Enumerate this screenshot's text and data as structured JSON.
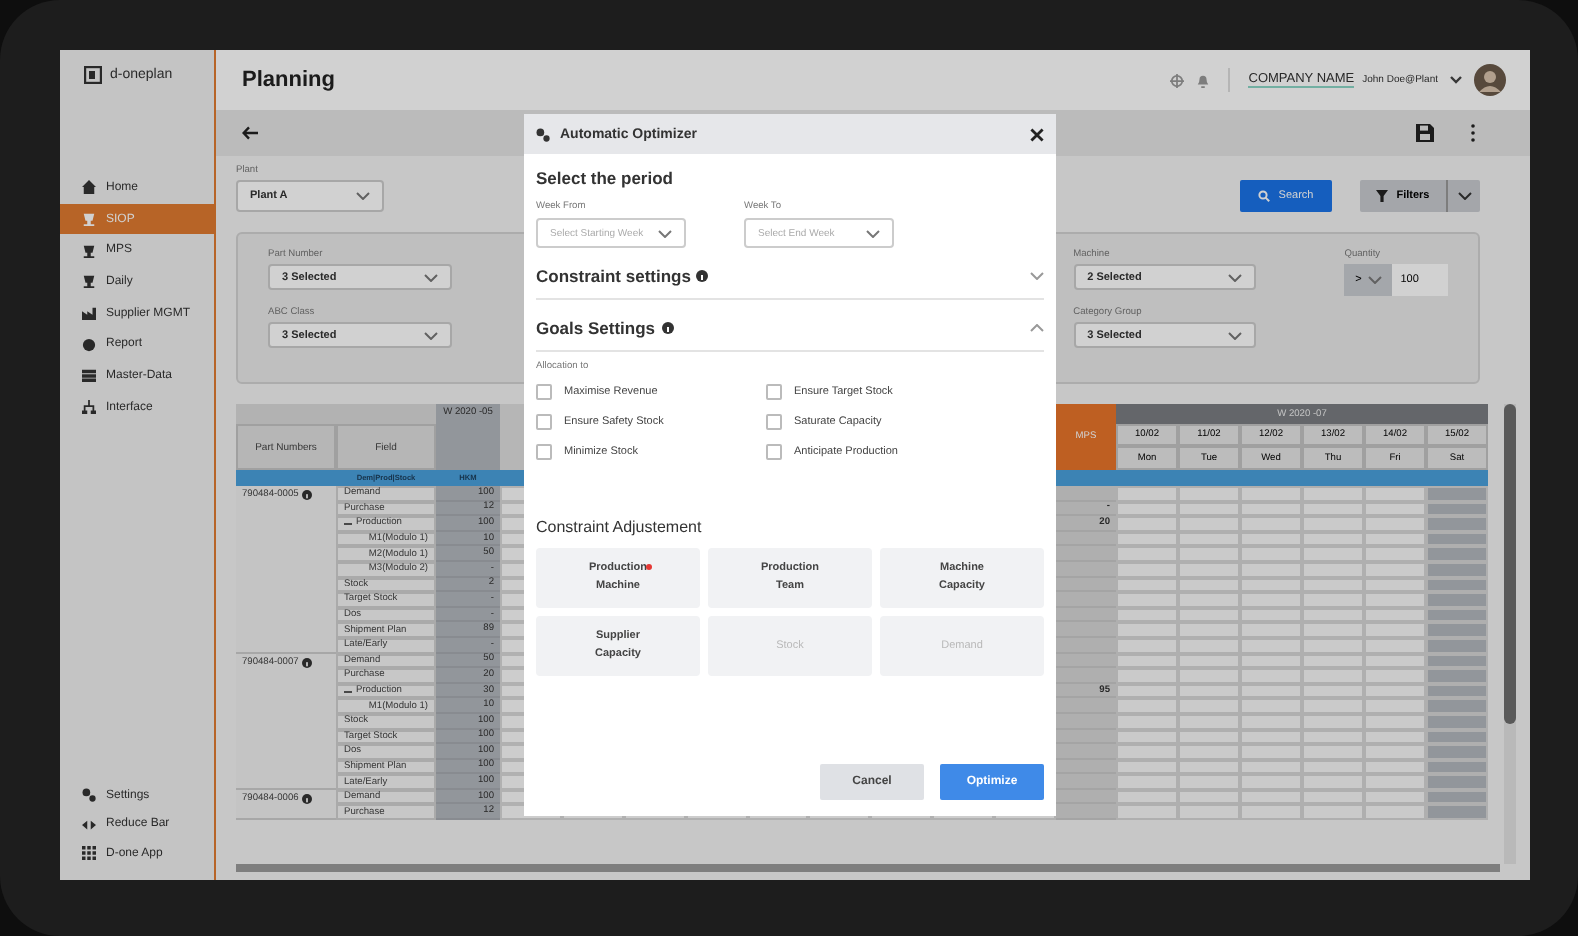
{
  "brand": {
    "name": "d-oneplan"
  },
  "sidebar": {
    "items": [
      {
        "label": "Home",
        "selected": false
      },
      {
        "label": "SIOP",
        "selected": true
      },
      {
        "label": "MPS",
        "selected": false
      },
      {
        "label": "Daily",
        "selected": false
      },
      {
        "label": "Supplier MGMT",
        "selected": false
      },
      {
        "label": "Report",
        "selected": false
      },
      {
        "label": "Master-Data",
        "selected": false
      },
      {
        "label": "Interface",
        "selected": false
      }
    ],
    "footer": [
      {
        "label": "Settings"
      },
      {
        "label": "Reduce Bar"
      },
      {
        "label": "D-one App"
      }
    ]
  },
  "header": {
    "title": "Planning",
    "company": "COMPANY NAME",
    "user": "John Doe@Plant"
  },
  "plant": {
    "label": "Plant",
    "value": "Plant A"
  },
  "search_button": {
    "label": "Search"
  },
  "filters_button": {
    "label": "Filters"
  },
  "filters": [
    {
      "label": "Part Number",
      "value": "3 Selected"
    },
    {
      "label": "ABC Class",
      "value": "3 Selected"
    },
    {
      "label": "Machine",
      "value": "2 Selected"
    },
    {
      "label": "Category Group",
      "value": "3 Selected"
    }
  ],
  "quantity": {
    "label": "Quantity",
    "operator": ">",
    "value": "100"
  },
  "table": {
    "part_header": "Part Numbers",
    "field_header": "Field",
    "week_a": "W 2020 -05",
    "mps_header": "MPS",
    "week_b": "W 2020 -07",
    "days": [
      {
        "date": "10/02",
        "day": "Mon"
      },
      {
        "date": "11/02",
        "day": "Tue"
      },
      {
        "date": "12/02",
        "day": "Wed"
      },
      {
        "date": "13/02",
        "day": "Thu"
      },
      {
        "date": "14/02",
        "day": "Fri"
      },
      {
        "date": "15/02",
        "day": "Sat"
      }
    ],
    "band": {
      "field": "Dem|Prod|Stock",
      "week_a": "HKM"
    },
    "groups": [
      {
        "part": "790484-0005",
        "rows": [
          {
            "field": "Demand",
            "week_a": "100"
          },
          {
            "field": "Purchase",
            "week_a": "12",
            "mps": "-"
          },
          {
            "field": "Production",
            "week_a": "100",
            "mps": "20",
            "expanded": true,
            "children": [
              {
                "field": "M1(Modulo 1)",
                "week_a": "10"
              },
              {
                "field": "M2(Modulo 1)",
                "week_a": "50"
              },
              {
                "field": "M3(Modulo 2)",
                "week_a": "-"
              }
            ]
          },
          {
            "field": "Stock",
            "week_a": "2"
          },
          {
            "field": "Target Stock",
            "week_a": "-"
          },
          {
            "field": "Dos",
            "week_a": "-"
          },
          {
            "field": "Shipment Plan",
            "week_a": "89"
          },
          {
            "field": "Late/Early",
            "week_a": "-"
          }
        ]
      },
      {
        "part": "790484-0007",
        "rows": [
          {
            "field": "Demand",
            "week_a": "50"
          },
          {
            "field": "Purchase",
            "week_a": "20"
          },
          {
            "field": "Production",
            "week_a": "30",
            "mps": "95",
            "expanded": true,
            "children": [
              {
                "field": "M1(Modulo 1)",
                "week_a": "10"
              }
            ]
          },
          {
            "field": "Stock",
            "week_a": "100"
          },
          {
            "field": "Target Stock",
            "week_a": "100"
          },
          {
            "field": "Dos",
            "week_a": "100"
          },
          {
            "field": "Shipment Plan",
            "week_a": "100"
          },
          {
            "field": "Late/Early",
            "week_a": "100"
          }
        ]
      },
      {
        "part": "790484-0006",
        "rows": [
          {
            "field": "Demand",
            "week_a": "100"
          },
          {
            "field": "Purchase",
            "week_a": "12"
          }
        ]
      }
    ]
  },
  "optimizer": {
    "title": "Automatic Optimizer",
    "period": {
      "title": "Select the period",
      "from": {
        "label": "Week From",
        "placeholder": "Select Starting Week"
      },
      "to": {
        "label": "Week To",
        "placeholder": "Select End Week"
      }
    },
    "sections": [
      {
        "title": "Constraint settings",
        "expanded": false
      },
      {
        "title": "Goals Settings",
        "expanded": true
      }
    ],
    "allocation_label": "Allocation to",
    "goals": [
      {
        "label": "Maximise Revenue",
        "checked": false
      },
      {
        "label": "Ensure Target Stock",
        "checked": false
      },
      {
        "label": "Ensure Safety Stock",
        "checked": false
      },
      {
        "label": "Saturate Capacity",
        "checked": false
      },
      {
        "label": "Minimize Stock",
        "checked": false
      },
      {
        "label": "Anticipate Production",
        "checked": false
      }
    ],
    "adjustment_title": "Constraint Adjustement",
    "tiles": [
      {
        "label": "Production Machine",
        "required": true,
        "disabled": false
      },
      {
        "label": "Production Team",
        "required": false,
        "disabled": false
      },
      {
        "label": "Machine Capacity",
        "required": false,
        "disabled": false
      },
      {
        "label": "Supplier Capacity",
        "required": false,
        "disabled": false
      },
      {
        "label": "Stock",
        "required": false,
        "disabled": true
      },
      {
        "label": "Demand",
        "required": false,
        "disabled": true
      }
    ],
    "buttons": [
      {
        "label": "Cancel",
        "kind": "secondary"
      },
      {
        "label": "Optimize",
        "kind": "primary"
      }
    ]
  }
}
